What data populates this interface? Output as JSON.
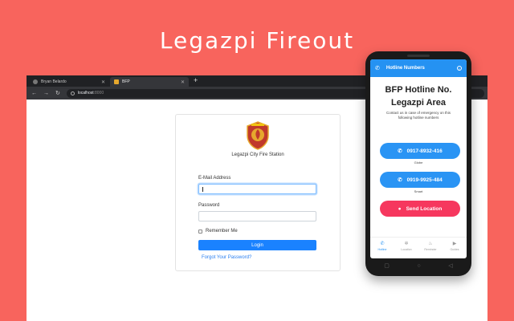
{
  "headline": "Legazpi Fireout",
  "browser": {
    "tabs": [
      {
        "label": "Bryan Belardo",
        "active": false
      },
      {
        "label": "BFP",
        "active": true
      }
    ],
    "url": {
      "host": "localhost",
      "port": ":8000"
    }
  },
  "login": {
    "station_name": "Legazpi City Fire Station",
    "email_label": "E-Mail Address",
    "email_value": "",
    "password_label": "Password",
    "password_value": "",
    "remember_label": "Remember Me",
    "login_button": "Login",
    "forgot_link": "Forgot Your Password?"
  },
  "phone": {
    "appbar_title": "Hotline Numbers",
    "heading_line1": "BFP Hotline No.",
    "heading_line2": "Legazpi Area",
    "subtitle": "Contact us in case of emergency on this following hotline numbers",
    "hotlines": [
      {
        "number": "0917-8932-416",
        "carrier": "Globe"
      },
      {
        "number": "0919-9925-484",
        "carrier": "Smart"
      }
    ],
    "send_location": "Send Location",
    "nav": [
      {
        "label": "Hotline",
        "icon": "phone-icon",
        "active": true
      },
      {
        "label": "Location",
        "icon": "gear-icon",
        "active": false
      },
      {
        "label": "Reminder",
        "icon": "fire-icon",
        "active": false
      },
      {
        "label": "Guides",
        "icon": "play-icon",
        "active": false
      }
    ]
  },
  "colors": {
    "background": "#f8645d",
    "primary_blue": "#2592f2",
    "send_red": "#f6375e",
    "login_blue": "#1a82ff"
  }
}
